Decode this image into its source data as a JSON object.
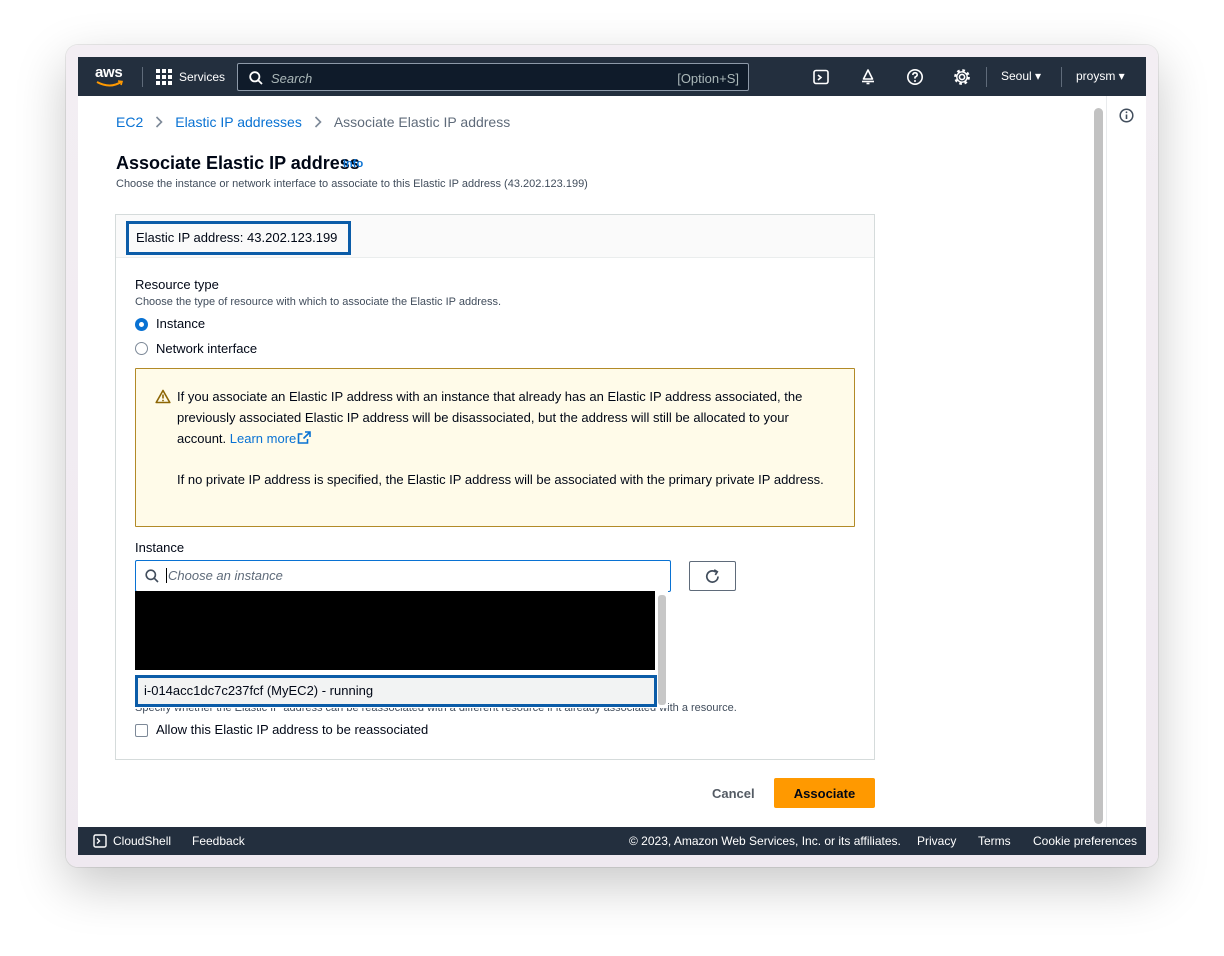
{
  "nav": {
    "logo": "aws",
    "services": "Services",
    "search_placeholder": "Search",
    "search_shortcut": "[Option+S]",
    "region": "Seoul ▾",
    "user": "proysm ▾",
    "icons": [
      "cloudshell-icon",
      "bell-icon",
      "help-icon",
      "gear-icon"
    ]
  },
  "breadcrumb": {
    "items": [
      "EC2",
      "Elastic IP addresses"
    ],
    "current": "Associate Elastic IP address"
  },
  "page": {
    "title": "Associate Elastic IP address",
    "info": "Info",
    "subtitle": "Choose the instance or network interface to associate to this Elastic IP address (43.202.123.199)"
  },
  "panel": {
    "header": "Elastic IP address: 43.202.123.199",
    "resource_type_label": "Resource type",
    "resource_type_desc": "Choose the type of resource with which to associate the Elastic IP address.",
    "options": [
      {
        "label": "Instance",
        "selected": true
      },
      {
        "label": "Network interface",
        "selected": false
      }
    ],
    "alert": {
      "p1": "If you associate an Elastic IP address with an instance that already has an Elastic IP address associated, the previously associated Elastic IP address will be disassociated, but the address will still be allocated to your account.",
      "learn_more": "Learn more",
      "p2": "If no private IP address is specified, the Elastic IP address will be associated with the primary private IP address."
    },
    "instance_label": "Instance",
    "instance_placeholder": "Choose an instance",
    "dropdown_option": "i-014acc1dc7c237fcf (MyEC2) - running",
    "reassoc_desc": "Specify whether the Elastic IP address can be reassociated with a different resource if it already associated with a resource.",
    "reassoc_checkbox": "Allow this Elastic IP address to be reassociated"
  },
  "actions": {
    "cancel": "Cancel",
    "associate": "Associate"
  },
  "footer": {
    "cloudshell": "CloudShell",
    "feedback": "Feedback",
    "copyright": "© 2023, Amazon Web Services, Inc. or its affiliates.",
    "privacy": "Privacy",
    "terms": "Terms",
    "cookies": "Cookie preferences"
  },
  "colors": {
    "nav_bg": "#232f3e",
    "link": "#0972d3",
    "primary_button": "#ff9900",
    "highlight_box": "#0b5ca8",
    "alert_bg": "#fffbe9"
  }
}
